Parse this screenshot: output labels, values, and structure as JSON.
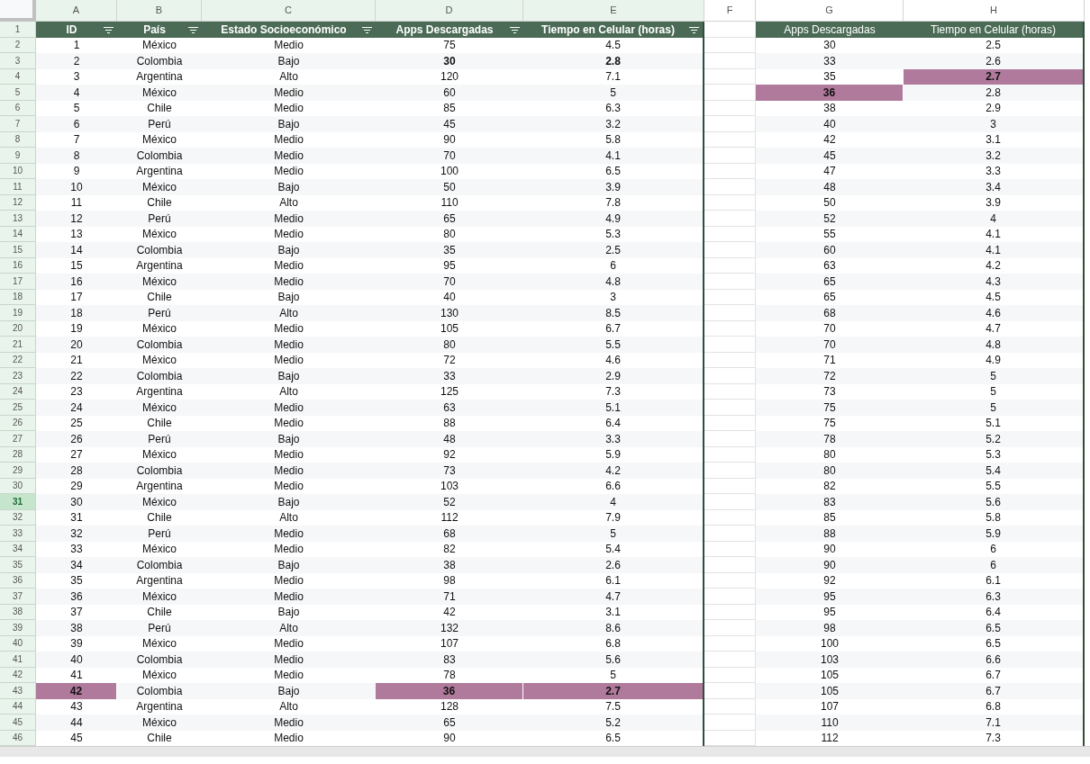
{
  "columns": [
    {
      "letter": "A",
      "filtered": true
    },
    {
      "letter": "B",
      "filtered": true
    },
    {
      "letter": "C",
      "filtered": true
    },
    {
      "letter": "D",
      "filtered": true
    },
    {
      "letter": "E",
      "filtered": true
    },
    {
      "letter": "F",
      "filtered": false
    },
    {
      "letter": "G",
      "filtered": false
    },
    {
      "letter": "H",
      "filtered": false
    }
  ],
  "header": {
    "number": "1",
    "left": [
      {
        "text": "ID",
        "filter": true
      },
      {
        "text": "País",
        "filter": true
      },
      {
        "text": "Estado Socioeconómico",
        "filter": true
      },
      {
        "text": "Apps Descargadas",
        "filter": true
      },
      {
        "text": "Tiempo en Celular (horas)",
        "filter": true
      }
    ],
    "right": [
      "Apps Descargadas",
      "Tiempo en Celular (horas)"
    ]
  },
  "rows": [
    {
      "number": "2",
      "selected": false,
      "left": [
        {
          "text": "1",
          "bold": false,
          "highlighted": false
        },
        {
          "text": "México",
          "bold": false,
          "highlighted": false
        },
        {
          "text": "Medio",
          "bold": false,
          "highlighted": false
        },
        {
          "text": "75",
          "bold": false,
          "highlighted": false
        },
        {
          "text": "4.5",
          "bold": false,
          "highlighted": false
        }
      ],
      "right": [
        {
          "text": "30",
          "bold": false,
          "highlighted": false
        },
        {
          "text": "2.5",
          "bold": false,
          "highlighted": false
        }
      ]
    },
    {
      "number": "3",
      "selected": false,
      "left": [
        {
          "text": "2",
          "bold": false,
          "highlighted": false
        },
        {
          "text": "Colombia",
          "bold": false,
          "highlighted": false
        },
        {
          "text": "Bajo",
          "bold": false,
          "highlighted": false
        },
        {
          "text": "30",
          "bold": true,
          "highlighted": false
        },
        {
          "text": "2.8",
          "bold": true,
          "highlighted": false
        }
      ],
      "right": [
        {
          "text": "33",
          "bold": false,
          "highlighted": false
        },
        {
          "text": "2.6",
          "bold": false,
          "highlighted": false
        }
      ]
    },
    {
      "number": "4",
      "selected": false,
      "left": [
        {
          "text": "3",
          "bold": false,
          "highlighted": false
        },
        {
          "text": "Argentina",
          "bold": false,
          "highlighted": false
        },
        {
          "text": "Alto",
          "bold": false,
          "highlighted": false
        },
        {
          "text": "120",
          "bold": false,
          "highlighted": false
        },
        {
          "text": "7.1",
          "bold": false,
          "highlighted": false
        }
      ],
      "right": [
        {
          "text": "35",
          "bold": false,
          "highlighted": false
        },
        {
          "text": "2.7",
          "bold": true,
          "highlighted": true
        }
      ]
    },
    {
      "number": "5",
      "selected": false,
      "left": [
        {
          "text": "4",
          "bold": false,
          "highlighted": false
        },
        {
          "text": "México",
          "bold": false,
          "highlighted": false
        },
        {
          "text": "Medio",
          "bold": false,
          "highlighted": false
        },
        {
          "text": "60",
          "bold": false,
          "highlighted": false
        },
        {
          "text": "5",
          "bold": false,
          "highlighted": false
        }
      ],
      "right": [
        {
          "text": "36",
          "bold": true,
          "highlighted": true
        },
        {
          "text": "2.8",
          "bold": false,
          "highlighted": false
        }
      ]
    },
    {
      "number": "6",
      "selected": false,
      "left": [
        {
          "text": "5",
          "bold": false,
          "highlighted": false
        },
        {
          "text": "Chile",
          "bold": false,
          "highlighted": false
        },
        {
          "text": "Medio",
          "bold": false,
          "highlighted": false
        },
        {
          "text": "85",
          "bold": false,
          "highlighted": false
        },
        {
          "text": "6.3",
          "bold": false,
          "highlighted": false
        }
      ],
      "right": [
        {
          "text": "38",
          "bold": false,
          "highlighted": false
        },
        {
          "text": "2.9",
          "bold": false,
          "highlighted": false
        }
      ]
    },
    {
      "number": "7",
      "selected": false,
      "left": [
        {
          "text": "6",
          "bold": false,
          "highlighted": false
        },
        {
          "text": "Perú",
          "bold": false,
          "highlighted": false
        },
        {
          "text": "Bajo",
          "bold": false,
          "highlighted": false
        },
        {
          "text": "45",
          "bold": false,
          "highlighted": false
        },
        {
          "text": "3.2",
          "bold": false,
          "highlighted": false
        }
      ],
      "right": [
        {
          "text": "40",
          "bold": false,
          "highlighted": false
        },
        {
          "text": "3",
          "bold": false,
          "highlighted": false
        }
      ]
    },
    {
      "number": "8",
      "selected": false,
      "left": [
        {
          "text": "7",
          "bold": false,
          "highlighted": false
        },
        {
          "text": "México",
          "bold": false,
          "highlighted": false
        },
        {
          "text": "Medio",
          "bold": false,
          "highlighted": false
        },
        {
          "text": "90",
          "bold": false,
          "highlighted": false
        },
        {
          "text": "5.8",
          "bold": false,
          "highlighted": false
        }
      ],
      "right": [
        {
          "text": "42",
          "bold": false,
          "highlighted": false
        },
        {
          "text": "3.1",
          "bold": false,
          "highlighted": false
        }
      ]
    },
    {
      "number": "9",
      "selected": false,
      "left": [
        {
          "text": "8",
          "bold": false,
          "highlighted": false
        },
        {
          "text": "Colombia",
          "bold": false,
          "highlighted": false
        },
        {
          "text": "Medio",
          "bold": false,
          "highlighted": false
        },
        {
          "text": "70",
          "bold": false,
          "highlighted": false
        },
        {
          "text": "4.1",
          "bold": false,
          "highlighted": false
        }
      ],
      "right": [
        {
          "text": "45",
          "bold": false,
          "highlighted": false
        },
        {
          "text": "3.2",
          "bold": false,
          "highlighted": false
        }
      ]
    },
    {
      "number": "10",
      "selected": false,
      "left": [
        {
          "text": "9",
          "bold": false,
          "highlighted": false
        },
        {
          "text": "Argentina",
          "bold": false,
          "highlighted": false
        },
        {
          "text": "Medio",
          "bold": false,
          "highlighted": false
        },
        {
          "text": "100",
          "bold": false,
          "highlighted": false
        },
        {
          "text": "6.5",
          "bold": false,
          "highlighted": false
        }
      ],
      "right": [
        {
          "text": "47",
          "bold": false,
          "highlighted": false
        },
        {
          "text": "3.3",
          "bold": false,
          "highlighted": false
        }
      ]
    },
    {
      "number": "11",
      "selected": false,
      "left": [
        {
          "text": "10",
          "bold": false,
          "highlighted": false
        },
        {
          "text": "México",
          "bold": false,
          "highlighted": false
        },
        {
          "text": "Bajo",
          "bold": false,
          "highlighted": false
        },
        {
          "text": "50",
          "bold": false,
          "highlighted": false
        },
        {
          "text": "3.9",
          "bold": false,
          "highlighted": false
        }
      ],
      "right": [
        {
          "text": "48",
          "bold": false,
          "highlighted": false
        },
        {
          "text": "3.4",
          "bold": false,
          "highlighted": false
        }
      ]
    },
    {
      "number": "12",
      "selected": false,
      "left": [
        {
          "text": "11",
          "bold": false,
          "highlighted": false
        },
        {
          "text": "Chile",
          "bold": false,
          "highlighted": false
        },
        {
          "text": "Alto",
          "bold": false,
          "highlighted": false
        },
        {
          "text": "110",
          "bold": false,
          "highlighted": false
        },
        {
          "text": "7.8",
          "bold": false,
          "highlighted": false
        }
      ],
      "right": [
        {
          "text": "50",
          "bold": false,
          "highlighted": false
        },
        {
          "text": "3.9",
          "bold": false,
          "highlighted": false
        }
      ]
    },
    {
      "number": "13",
      "selected": false,
      "left": [
        {
          "text": "12",
          "bold": false,
          "highlighted": false
        },
        {
          "text": "Perú",
          "bold": false,
          "highlighted": false
        },
        {
          "text": "Medio",
          "bold": false,
          "highlighted": false
        },
        {
          "text": "65",
          "bold": false,
          "highlighted": false
        },
        {
          "text": "4.9",
          "bold": false,
          "highlighted": false
        }
      ],
      "right": [
        {
          "text": "52",
          "bold": false,
          "highlighted": false
        },
        {
          "text": "4",
          "bold": false,
          "highlighted": false
        }
      ]
    },
    {
      "number": "14",
      "selected": false,
      "left": [
        {
          "text": "13",
          "bold": false,
          "highlighted": false
        },
        {
          "text": "México",
          "bold": false,
          "highlighted": false
        },
        {
          "text": "Medio",
          "bold": false,
          "highlighted": false
        },
        {
          "text": "80",
          "bold": false,
          "highlighted": false
        },
        {
          "text": "5.3",
          "bold": false,
          "highlighted": false
        }
      ],
      "right": [
        {
          "text": "55",
          "bold": false,
          "highlighted": false
        },
        {
          "text": "4.1",
          "bold": false,
          "highlighted": false
        }
      ]
    },
    {
      "number": "15",
      "selected": false,
      "left": [
        {
          "text": "14",
          "bold": false,
          "highlighted": false
        },
        {
          "text": "Colombia",
          "bold": false,
          "highlighted": false
        },
        {
          "text": "Bajo",
          "bold": false,
          "highlighted": false
        },
        {
          "text": "35",
          "bold": false,
          "highlighted": false
        },
        {
          "text": "2.5",
          "bold": false,
          "highlighted": false
        }
      ],
      "right": [
        {
          "text": "60",
          "bold": false,
          "highlighted": false
        },
        {
          "text": "4.1",
          "bold": false,
          "highlighted": false
        }
      ]
    },
    {
      "number": "16",
      "selected": false,
      "left": [
        {
          "text": "15",
          "bold": false,
          "highlighted": false
        },
        {
          "text": "Argentina",
          "bold": false,
          "highlighted": false
        },
        {
          "text": "Medio",
          "bold": false,
          "highlighted": false
        },
        {
          "text": "95",
          "bold": false,
          "highlighted": false
        },
        {
          "text": "6",
          "bold": false,
          "highlighted": false
        }
      ],
      "right": [
        {
          "text": "63",
          "bold": false,
          "highlighted": false
        },
        {
          "text": "4.2",
          "bold": false,
          "highlighted": false
        }
      ]
    },
    {
      "number": "17",
      "selected": false,
      "left": [
        {
          "text": "16",
          "bold": false,
          "highlighted": false
        },
        {
          "text": "México",
          "bold": false,
          "highlighted": false
        },
        {
          "text": "Medio",
          "bold": false,
          "highlighted": false
        },
        {
          "text": "70",
          "bold": false,
          "highlighted": false
        },
        {
          "text": "4.8",
          "bold": false,
          "highlighted": false
        }
      ],
      "right": [
        {
          "text": "65",
          "bold": false,
          "highlighted": false
        },
        {
          "text": "4.3",
          "bold": false,
          "highlighted": false
        }
      ]
    },
    {
      "number": "18",
      "selected": false,
      "left": [
        {
          "text": "17",
          "bold": false,
          "highlighted": false
        },
        {
          "text": "Chile",
          "bold": false,
          "highlighted": false
        },
        {
          "text": "Bajo",
          "bold": false,
          "highlighted": false
        },
        {
          "text": "40",
          "bold": false,
          "highlighted": false
        },
        {
          "text": "3",
          "bold": false,
          "highlighted": false
        }
      ],
      "right": [
        {
          "text": "65",
          "bold": false,
          "highlighted": false
        },
        {
          "text": "4.5",
          "bold": false,
          "highlighted": false
        }
      ]
    },
    {
      "number": "19",
      "selected": false,
      "left": [
        {
          "text": "18",
          "bold": false,
          "highlighted": false
        },
        {
          "text": "Perú",
          "bold": false,
          "highlighted": false
        },
        {
          "text": "Alto",
          "bold": false,
          "highlighted": false
        },
        {
          "text": "130",
          "bold": false,
          "highlighted": false
        },
        {
          "text": "8.5",
          "bold": false,
          "highlighted": false
        }
      ],
      "right": [
        {
          "text": "68",
          "bold": false,
          "highlighted": false
        },
        {
          "text": "4.6",
          "bold": false,
          "highlighted": false
        }
      ]
    },
    {
      "number": "20",
      "selected": false,
      "left": [
        {
          "text": "19",
          "bold": false,
          "highlighted": false
        },
        {
          "text": "México",
          "bold": false,
          "highlighted": false
        },
        {
          "text": "Medio",
          "bold": false,
          "highlighted": false
        },
        {
          "text": "105",
          "bold": false,
          "highlighted": false
        },
        {
          "text": "6.7",
          "bold": false,
          "highlighted": false
        }
      ],
      "right": [
        {
          "text": "70",
          "bold": false,
          "highlighted": false
        },
        {
          "text": "4.7",
          "bold": false,
          "highlighted": false
        }
      ]
    },
    {
      "number": "21",
      "selected": false,
      "left": [
        {
          "text": "20",
          "bold": false,
          "highlighted": false
        },
        {
          "text": "Colombia",
          "bold": false,
          "highlighted": false
        },
        {
          "text": "Medio",
          "bold": false,
          "highlighted": false
        },
        {
          "text": "80",
          "bold": false,
          "highlighted": false
        },
        {
          "text": "5.5",
          "bold": false,
          "highlighted": false
        }
      ],
      "right": [
        {
          "text": "70",
          "bold": false,
          "highlighted": false
        },
        {
          "text": "4.8",
          "bold": false,
          "highlighted": false
        }
      ]
    },
    {
      "number": "22",
      "selected": false,
      "left": [
        {
          "text": "21",
          "bold": false,
          "highlighted": false
        },
        {
          "text": "México",
          "bold": false,
          "highlighted": false
        },
        {
          "text": "Medio",
          "bold": false,
          "highlighted": false
        },
        {
          "text": "72",
          "bold": false,
          "highlighted": false
        },
        {
          "text": "4.6",
          "bold": false,
          "highlighted": false
        }
      ],
      "right": [
        {
          "text": "71",
          "bold": false,
          "highlighted": false
        },
        {
          "text": "4.9",
          "bold": false,
          "highlighted": false
        }
      ]
    },
    {
      "number": "23",
      "selected": false,
      "left": [
        {
          "text": "22",
          "bold": false,
          "highlighted": false
        },
        {
          "text": "Colombia",
          "bold": false,
          "highlighted": false
        },
        {
          "text": "Bajo",
          "bold": false,
          "highlighted": false
        },
        {
          "text": "33",
          "bold": false,
          "highlighted": false
        },
        {
          "text": "2.9",
          "bold": false,
          "highlighted": false
        }
      ],
      "right": [
        {
          "text": "72",
          "bold": false,
          "highlighted": false
        },
        {
          "text": "5",
          "bold": false,
          "highlighted": false
        }
      ]
    },
    {
      "number": "24",
      "selected": false,
      "left": [
        {
          "text": "23",
          "bold": false,
          "highlighted": false
        },
        {
          "text": "Argentina",
          "bold": false,
          "highlighted": false
        },
        {
          "text": "Alto",
          "bold": false,
          "highlighted": false
        },
        {
          "text": "125",
          "bold": false,
          "highlighted": false
        },
        {
          "text": "7.3",
          "bold": false,
          "highlighted": false
        }
      ],
      "right": [
        {
          "text": "73",
          "bold": false,
          "highlighted": false
        },
        {
          "text": "5",
          "bold": false,
          "highlighted": false
        }
      ]
    },
    {
      "number": "25",
      "selected": false,
      "left": [
        {
          "text": "24",
          "bold": false,
          "highlighted": false
        },
        {
          "text": "México",
          "bold": false,
          "highlighted": false
        },
        {
          "text": "Medio",
          "bold": false,
          "highlighted": false
        },
        {
          "text": "63",
          "bold": false,
          "highlighted": false
        },
        {
          "text": "5.1",
          "bold": false,
          "highlighted": false
        }
      ],
      "right": [
        {
          "text": "75",
          "bold": false,
          "highlighted": false
        },
        {
          "text": "5",
          "bold": false,
          "highlighted": false
        }
      ]
    },
    {
      "number": "26",
      "selected": false,
      "left": [
        {
          "text": "25",
          "bold": false,
          "highlighted": false
        },
        {
          "text": "Chile",
          "bold": false,
          "highlighted": false
        },
        {
          "text": "Medio",
          "bold": false,
          "highlighted": false
        },
        {
          "text": "88",
          "bold": false,
          "highlighted": false
        },
        {
          "text": "6.4",
          "bold": false,
          "highlighted": false
        }
      ],
      "right": [
        {
          "text": "75",
          "bold": false,
          "highlighted": false
        },
        {
          "text": "5.1",
          "bold": false,
          "highlighted": false
        }
      ]
    },
    {
      "number": "27",
      "selected": false,
      "left": [
        {
          "text": "26",
          "bold": false,
          "highlighted": false
        },
        {
          "text": "Perú",
          "bold": false,
          "highlighted": false
        },
        {
          "text": "Bajo",
          "bold": false,
          "highlighted": false
        },
        {
          "text": "48",
          "bold": false,
          "highlighted": false
        },
        {
          "text": "3.3",
          "bold": false,
          "highlighted": false
        }
      ],
      "right": [
        {
          "text": "78",
          "bold": false,
          "highlighted": false
        },
        {
          "text": "5.2",
          "bold": false,
          "highlighted": false
        }
      ]
    },
    {
      "number": "28",
      "selected": false,
      "left": [
        {
          "text": "27",
          "bold": false,
          "highlighted": false
        },
        {
          "text": "México",
          "bold": false,
          "highlighted": false
        },
        {
          "text": "Medio",
          "bold": false,
          "highlighted": false
        },
        {
          "text": "92",
          "bold": false,
          "highlighted": false
        },
        {
          "text": "5.9",
          "bold": false,
          "highlighted": false
        }
      ],
      "right": [
        {
          "text": "80",
          "bold": false,
          "highlighted": false
        },
        {
          "text": "5.3",
          "bold": false,
          "highlighted": false
        }
      ]
    },
    {
      "number": "29",
      "selected": false,
      "left": [
        {
          "text": "28",
          "bold": false,
          "highlighted": false
        },
        {
          "text": "Colombia",
          "bold": false,
          "highlighted": false
        },
        {
          "text": "Medio",
          "bold": false,
          "highlighted": false
        },
        {
          "text": "73",
          "bold": false,
          "highlighted": false
        },
        {
          "text": "4.2",
          "bold": false,
          "highlighted": false
        }
      ],
      "right": [
        {
          "text": "80",
          "bold": false,
          "highlighted": false
        },
        {
          "text": "5.4",
          "bold": false,
          "highlighted": false
        }
      ]
    },
    {
      "number": "30",
      "selected": false,
      "left": [
        {
          "text": "29",
          "bold": false,
          "highlighted": false
        },
        {
          "text": "Argentina",
          "bold": false,
          "highlighted": false
        },
        {
          "text": "Medio",
          "bold": false,
          "highlighted": false
        },
        {
          "text": "103",
          "bold": false,
          "highlighted": false
        },
        {
          "text": "6.6",
          "bold": false,
          "highlighted": false
        }
      ],
      "right": [
        {
          "text": "82",
          "bold": false,
          "highlighted": false
        },
        {
          "text": "5.5",
          "bold": false,
          "highlighted": false
        }
      ]
    },
    {
      "number": "31",
      "selected": true,
      "left": [
        {
          "text": "30",
          "bold": false,
          "highlighted": false
        },
        {
          "text": "México",
          "bold": false,
          "highlighted": false
        },
        {
          "text": "Bajo",
          "bold": false,
          "highlighted": false
        },
        {
          "text": "52",
          "bold": false,
          "highlighted": false
        },
        {
          "text": "4",
          "bold": false,
          "highlighted": false
        }
      ],
      "right": [
        {
          "text": "83",
          "bold": false,
          "highlighted": false
        },
        {
          "text": "5.6",
          "bold": false,
          "highlighted": false
        }
      ]
    },
    {
      "number": "32",
      "selected": false,
      "left": [
        {
          "text": "31",
          "bold": false,
          "highlighted": false
        },
        {
          "text": "Chile",
          "bold": false,
          "highlighted": false
        },
        {
          "text": "Alto",
          "bold": false,
          "highlighted": false
        },
        {
          "text": "112",
          "bold": false,
          "highlighted": false
        },
        {
          "text": "7.9",
          "bold": false,
          "highlighted": false
        }
      ],
      "right": [
        {
          "text": "85",
          "bold": false,
          "highlighted": false
        },
        {
          "text": "5.8",
          "bold": false,
          "highlighted": false
        }
      ]
    },
    {
      "number": "33",
      "selected": false,
      "left": [
        {
          "text": "32",
          "bold": false,
          "highlighted": false
        },
        {
          "text": "Perú",
          "bold": false,
          "highlighted": false
        },
        {
          "text": "Medio",
          "bold": false,
          "highlighted": false
        },
        {
          "text": "68",
          "bold": false,
          "highlighted": false
        },
        {
          "text": "5",
          "bold": false,
          "highlighted": false
        }
      ],
      "right": [
        {
          "text": "88",
          "bold": false,
          "highlighted": false
        },
        {
          "text": "5.9",
          "bold": false,
          "highlighted": false
        }
      ]
    },
    {
      "number": "34",
      "selected": false,
      "left": [
        {
          "text": "33",
          "bold": false,
          "highlighted": false
        },
        {
          "text": "México",
          "bold": false,
          "highlighted": false
        },
        {
          "text": "Medio",
          "bold": false,
          "highlighted": false
        },
        {
          "text": "82",
          "bold": false,
          "highlighted": false
        },
        {
          "text": "5.4",
          "bold": false,
          "highlighted": false
        }
      ],
      "right": [
        {
          "text": "90",
          "bold": false,
          "highlighted": false
        },
        {
          "text": "6",
          "bold": false,
          "highlighted": false
        }
      ]
    },
    {
      "number": "35",
      "selected": false,
      "left": [
        {
          "text": "34",
          "bold": false,
          "highlighted": false
        },
        {
          "text": "Colombia",
          "bold": false,
          "highlighted": false
        },
        {
          "text": "Bajo",
          "bold": false,
          "highlighted": false
        },
        {
          "text": "38",
          "bold": false,
          "highlighted": false
        },
        {
          "text": "2.6",
          "bold": false,
          "highlighted": false
        }
      ],
      "right": [
        {
          "text": "90",
          "bold": false,
          "highlighted": false
        },
        {
          "text": "6",
          "bold": false,
          "highlighted": false
        }
      ]
    },
    {
      "number": "36",
      "selected": false,
      "left": [
        {
          "text": "35",
          "bold": false,
          "highlighted": false
        },
        {
          "text": "Argentina",
          "bold": false,
          "highlighted": false
        },
        {
          "text": "Medio",
          "bold": false,
          "highlighted": false
        },
        {
          "text": "98",
          "bold": false,
          "highlighted": false
        },
        {
          "text": "6.1",
          "bold": false,
          "highlighted": false
        }
      ],
      "right": [
        {
          "text": "92",
          "bold": false,
          "highlighted": false
        },
        {
          "text": "6.1",
          "bold": false,
          "highlighted": false
        }
      ]
    },
    {
      "number": "37",
      "selected": false,
      "left": [
        {
          "text": "36",
          "bold": false,
          "highlighted": false
        },
        {
          "text": "México",
          "bold": false,
          "highlighted": false
        },
        {
          "text": "Medio",
          "bold": false,
          "highlighted": false
        },
        {
          "text": "71",
          "bold": false,
          "highlighted": false
        },
        {
          "text": "4.7",
          "bold": false,
          "highlighted": false
        }
      ],
      "right": [
        {
          "text": "95",
          "bold": false,
          "highlighted": false
        },
        {
          "text": "6.3",
          "bold": false,
          "highlighted": false
        }
      ]
    },
    {
      "number": "38",
      "selected": false,
      "left": [
        {
          "text": "37",
          "bold": false,
          "highlighted": false
        },
        {
          "text": "Chile",
          "bold": false,
          "highlighted": false
        },
        {
          "text": "Bajo",
          "bold": false,
          "highlighted": false
        },
        {
          "text": "42",
          "bold": false,
          "highlighted": false
        },
        {
          "text": "3.1",
          "bold": false,
          "highlighted": false
        }
      ],
      "right": [
        {
          "text": "95",
          "bold": false,
          "highlighted": false
        },
        {
          "text": "6.4",
          "bold": false,
          "highlighted": false
        }
      ]
    },
    {
      "number": "39",
      "selected": false,
      "left": [
        {
          "text": "38",
          "bold": false,
          "highlighted": false
        },
        {
          "text": "Perú",
          "bold": false,
          "highlighted": false
        },
        {
          "text": "Alto",
          "bold": false,
          "highlighted": false
        },
        {
          "text": "132",
          "bold": false,
          "highlighted": false
        },
        {
          "text": "8.6",
          "bold": false,
          "highlighted": false
        }
      ],
      "right": [
        {
          "text": "98",
          "bold": false,
          "highlighted": false
        },
        {
          "text": "6.5",
          "bold": false,
          "highlighted": false
        }
      ]
    },
    {
      "number": "40",
      "selected": false,
      "left": [
        {
          "text": "39",
          "bold": false,
          "highlighted": false
        },
        {
          "text": "México",
          "bold": false,
          "highlighted": false
        },
        {
          "text": "Medio",
          "bold": false,
          "highlighted": false
        },
        {
          "text": "107",
          "bold": false,
          "highlighted": false
        },
        {
          "text": "6.8",
          "bold": false,
          "highlighted": false
        }
      ],
      "right": [
        {
          "text": "100",
          "bold": false,
          "highlighted": false
        },
        {
          "text": "6.5",
          "bold": false,
          "highlighted": false
        }
      ]
    },
    {
      "number": "41",
      "selected": false,
      "left": [
        {
          "text": "40",
          "bold": false,
          "highlighted": false
        },
        {
          "text": "Colombia",
          "bold": false,
          "highlighted": false
        },
        {
          "text": "Medio",
          "bold": false,
          "highlighted": false
        },
        {
          "text": "83",
          "bold": false,
          "highlighted": false
        },
        {
          "text": "5.6",
          "bold": false,
          "highlighted": false
        }
      ],
      "right": [
        {
          "text": "103",
          "bold": false,
          "highlighted": false
        },
        {
          "text": "6.6",
          "bold": false,
          "highlighted": false
        }
      ]
    },
    {
      "number": "42",
      "selected": false,
      "left": [
        {
          "text": "41",
          "bold": false,
          "highlighted": false
        },
        {
          "text": "México",
          "bold": false,
          "highlighted": false
        },
        {
          "text": "Medio",
          "bold": false,
          "highlighted": false
        },
        {
          "text": "78",
          "bold": false,
          "highlighted": false
        },
        {
          "text": "5",
          "bold": false,
          "highlighted": false
        }
      ],
      "right": [
        {
          "text": "105",
          "bold": false,
          "highlighted": false
        },
        {
          "text": "6.7",
          "bold": false,
          "highlighted": false
        }
      ]
    },
    {
      "number": "43",
      "selected": false,
      "left": [
        {
          "text": "42",
          "bold": true,
          "highlighted": true
        },
        {
          "text": "Colombia",
          "bold": false,
          "highlighted": false
        },
        {
          "text": "Bajo",
          "bold": false,
          "highlighted": false
        },
        {
          "text": "36",
          "bold": true,
          "highlighted": true
        },
        {
          "text": "2.7",
          "bold": true,
          "highlighted": true
        }
      ],
      "right": [
        {
          "text": "105",
          "bold": false,
          "highlighted": false
        },
        {
          "text": "6.7",
          "bold": false,
          "highlighted": false
        }
      ]
    },
    {
      "number": "44",
      "selected": false,
      "left": [
        {
          "text": "43",
          "bold": false,
          "highlighted": false
        },
        {
          "text": "Argentina",
          "bold": false,
          "highlighted": false
        },
        {
          "text": "Alto",
          "bold": false,
          "highlighted": false
        },
        {
          "text": "128",
          "bold": false,
          "highlighted": false
        },
        {
          "text": "7.5",
          "bold": false,
          "highlighted": false
        }
      ],
      "right": [
        {
          "text": "107",
          "bold": false,
          "highlighted": false
        },
        {
          "text": "6.8",
          "bold": false,
          "highlighted": false
        }
      ]
    },
    {
      "number": "45",
      "selected": false,
      "left": [
        {
          "text": "44",
          "bold": false,
          "highlighted": false
        },
        {
          "text": "México",
          "bold": false,
          "highlighted": false
        },
        {
          "text": "Medio",
          "bold": false,
          "highlighted": false
        },
        {
          "text": "65",
          "bold": false,
          "highlighted": false
        },
        {
          "text": "5.2",
          "bold": false,
          "highlighted": false
        }
      ],
      "right": [
        {
          "text": "110",
          "bold": false,
          "highlighted": false
        },
        {
          "text": "7.1",
          "bold": false,
          "highlighted": false
        }
      ]
    },
    {
      "number": "46",
      "selected": false,
      "left": [
        {
          "text": "45",
          "bold": false,
          "highlighted": false
        },
        {
          "text": "Chile",
          "bold": false,
          "highlighted": false
        },
        {
          "text": "Medio",
          "bold": false,
          "highlighted": false
        },
        {
          "text": "90",
          "bold": false,
          "highlighted": false
        },
        {
          "text": "6.5",
          "bold": false,
          "highlighted": false
        }
      ],
      "right": [
        {
          "text": "112",
          "bold": false,
          "highlighted": false
        },
        {
          "text": "7.3",
          "bold": false,
          "highlighted": false
        }
      ]
    }
  ]
}
